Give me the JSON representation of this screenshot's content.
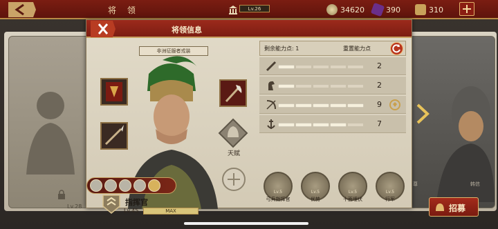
{
  "topbar": {
    "title": "将 领",
    "level_label": "Lv.26",
    "resources": [
      {
        "name": "coins",
        "value": "34620"
      },
      {
        "name": "gems",
        "value": "390"
      },
      {
        "name": "food",
        "value": "310"
      }
    ]
  },
  "panel": {
    "title": "将领信息",
    "set_name": "非洲征服者戎装",
    "talent_label": "天赋",
    "hero": {
      "name": "指挥官",
      "level": "Lv.45",
      "xp_text": "MAX",
      "xp_fraction": 1.0
    },
    "stats": {
      "remaining_label": "剩余能力点: 1",
      "reset_label": "重置能力点",
      "rows": [
        {
          "icon": "sword-icon",
          "value": "2",
          "filled": 2
        },
        {
          "icon": "horse-icon",
          "value": "2",
          "filled": 2
        },
        {
          "icon": "bow-icon",
          "value": "9",
          "filled": 9
        },
        {
          "icon": "anchor-icon",
          "value": "7",
          "filled": 7
        }
      ]
    },
    "skills": [
      {
        "level": "Lv.5",
        "name": "弓兵指挥官"
      },
      {
        "level": "Lv.5",
        "name": "优势"
      },
      {
        "level": "Lv.5",
        "name": "十面埋伏"
      },
      {
        "level": "Lv.5",
        "name": "行军"
      }
    ]
  },
  "background": {
    "locked_card_level": "Lv.28",
    "right_names": [
      "尊",
      "韩信"
    ]
  },
  "buttons": {
    "recruit": "招募"
  },
  "colors": {
    "accent_red": "#7b1d12",
    "gold_trim": "#c8a060",
    "panel_bg": "#e2dbc9"
  }
}
